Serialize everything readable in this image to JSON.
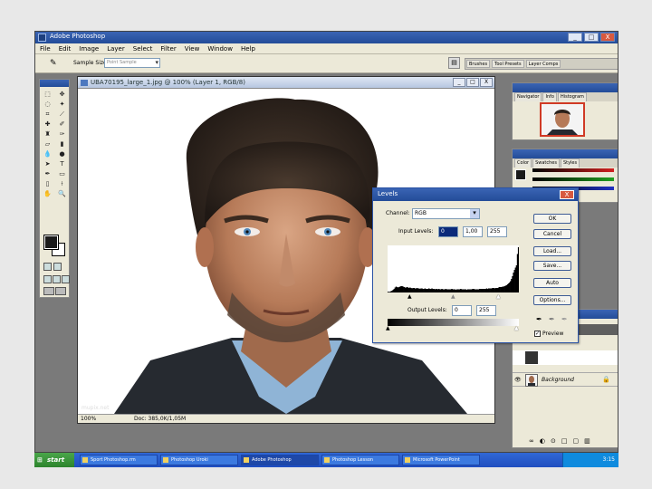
{
  "app": {
    "title": "Adobe Photoshop",
    "window_buttons": [
      "_",
      "□",
      "X"
    ]
  },
  "menu": [
    "File",
    "Edit",
    "Image",
    "Layer",
    "Select",
    "Filter",
    "View",
    "Window",
    "Help"
  ],
  "options": {
    "sample_size_label": "Sample Size:",
    "sample_size_value": "Point Sample",
    "well_tabs": [
      "Brushes",
      "Tool Presets",
      "Layer Comps"
    ]
  },
  "document": {
    "title": "UBA70195_large_1.jpg @ 100% (Layer 1, RGB/8)",
    "zoom": "100%",
    "doc_size": "Doc: 385,0K/1,05M",
    "watermark": "mupix.net",
    "buttons": [
      "_",
      "□",
      "X"
    ]
  },
  "navigator": {
    "tabs": [
      "Navigator",
      "Info",
      "Histogram"
    ]
  },
  "color_panel": {
    "tabs": [
      "Color",
      "Swatches",
      "Styles"
    ],
    "slider_colors": [
      "#d12020",
      "#20a020",
      "#2030c0"
    ]
  },
  "layers": {
    "background_label": "Background",
    "footer_icons": [
      "∞",
      "◐",
      "⊙",
      "□",
      "▢",
      "▥"
    ]
  },
  "levels": {
    "title": "Levels",
    "close": "X",
    "channel_label": "Channel:",
    "channel_value": "RGB",
    "input_label": "Input Levels:",
    "input_values": [
      "0",
      "1,00",
      "255"
    ],
    "output_label": "Output Levels:",
    "output_values": [
      "0",
      "255"
    ],
    "buttons": {
      "ok": "OK",
      "cancel": "Cancel",
      "load": "Load...",
      "save": "Save...",
      "auto": "Auto",
      "options": "Options..."
    },
    "preview_label": "Preview",
    "histogram": [
      2,
      1,
      2,
      3,
      4,
      6,
      8,
      11,
      13,
      12,
      11,
      12,
      13,
      14,
      14,
      13,
      12,
      11,
      11,
      12,
      11,
      10,
      11,
      10,
      9,
      10,
      10,
      9,
      9,
      10,
      9,
      9,
      8,
      9,
      9,
      8,
      8,
      9,
      8,
      8,
      8,
      9,
      8,
      8,
      9,
      8,
      8,
      7,
      8,
      8,
      7,
      8,
      7,
      7,
      8,
      7,
      7,
      7,
      8,
      7,
      7,
      7,
      7,
      7,
      8,
      7,
      7,
      7,
      6,
      7,
      7,
      7,
      7,
      8,
      7,
      7,
      7,
      7,
      7,
      6,
      7,
      7,
      7,
      7,
      7,
      8,
      8,
      7,
      7,
      7,
      7,
      7,
      8,
      8,
      8,
      8,
      8,
      8,
      8,
      9,
      8,
      9,
      9,
      9,
      9,
      10,
      10,
      9,
      10,
      10,
      10,
      11,
      12,
      12,
      12,
      13,
      13,
      14,
      15,
      16,
      18,
      20,
      22,
      25,
      30,
      36,
      44,
      50,
      55,
      60,
      85,
      100
    ]
  },
  "taskbar": {
    "start_label": "start",
    "tasks": [
      "Sport Photoshop.rm",
      "Photoshop Uroki",
      "Adobe Photoshop",
      "Photoshop Lesson",
      "Microsoft PowerPoint"
    ],
    "clock": "3:15"
  }
}
